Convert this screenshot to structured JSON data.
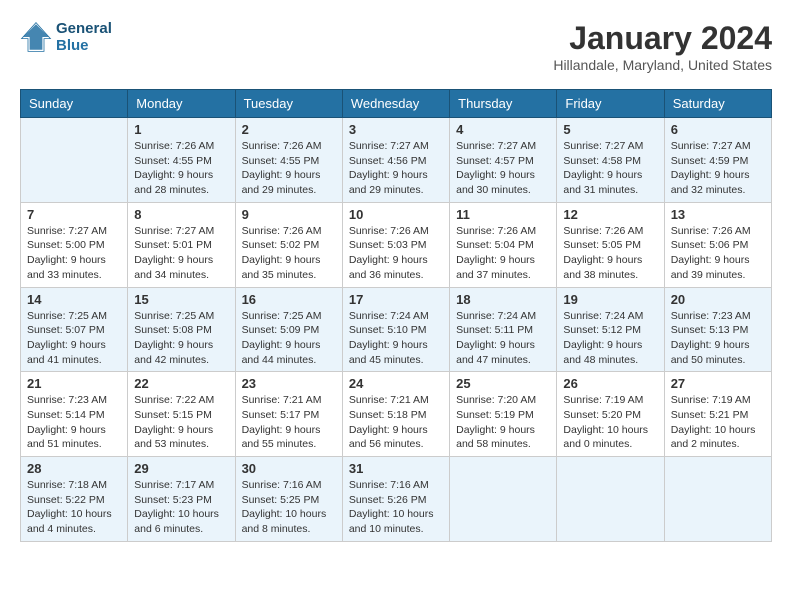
{
  "header": {
    "logo_line1": "General",
    "logo_line2": "Blue",
    "month": "January 2024",
    "location": "Hillandale, Maryland, United States"
  },
  "days_of_week": [
    "Sunday",
    "Monday",
    "Tuesday",
    "Wednesday",
    "Thursday",
    "Friday",
    "Saturday"
  ],
  "weeks": [
    [
      {
        "day": "",
        "info": ""
      },
      {
        "day": "1",
        "info": "Sunrise: 7:26 AM\nSunset: 4:55 PM\nDaylight: 9 hours\nand 28 minutes."
      },
      {
        "day": "2",
        "info": "Sunrise: 7:26 AM\nSunset: 4:55 PM\nDaylight: 9 hours\nand 29 minutes."
      },
      {
        "day": "3",
        "info": "Sunrise: 7:27 AM\nSunset: 4:56 PM\nDaylight: 9 hours\nand 29 minutes."
      },
      {
        "day": "4",
        "info": "Sunrise: 7:27 AM\nSunset: 4:57 PM\nDaylight: 9 hours\nand 30 minutes."
      },
      {
        "day": "5",
        "info": "Sunrise: 7:27 AM\nSunset: 4:58 PM\nDaylight: 9 hours\nand 31 minutes."
      },
      {
        "day": "6",
        "info": "Sunrise: 7:27 AM\nSunset: 4:59 PM\nDaylight: 9 hours\nand 32 minutes."
      }
    ],
    [
      {
        "day": "7",
        "info": "Sunrise: 7:27 AM\nSunset: 5:00 PM\nDaylight: 9 hours\nand 33 minutes."
      },
      {
        "day": "8",
        "info": "Sunrise: 7:27 AM\nSunset: 5:01 PM\nDaylight: 9 hours\nand 34 minutes."
      },
      {
        "day": "9",
        "info": "Sunrise: 7:26 AM\nSunset: 5:02 PM\nDaylight: 9 hours\nand 35 minutes."
      },
      {
        "day": "10",
        "info": "Sunrise: 7:26 AM\nSunset: 5:03 PM\nDaylight: 9 hours\nand 36 minutes."
      },
      {
        "day": "11",
        "info": "Sunrise: 7:26 AM\nSunset: 5:04 PM\nDaylight: 9 hours\nand 37 minutes."
      },
      {
        "day": "12",
        "info": "Sunrise: 7:26 AM\nSunset: 5:05 PM\nDaylight: 9 hours\nand 38 minutes."
      },
      {
        "day": "13",
        "info": "Sunrise: 7:26 AM\nSunset: 5:06 PM\nDaylight: 9 hours\nand 39 minutes."
      }
    ],
    [
      {
        "day": "14",
        "info": "Sunrise: 7:25 AM\nSunset: 5:07 PM\nDaylight: 9 hours\nand 41 minutes."
      },
      {
        "day": "15",
        "info": "Sunrise: 7:25 AM\nSunset: 5:08 PM\nDaylight: 9 hours\nand 42 minutes."
      },
      {
        "day": "16",
        "info": "Sunrise: 7:25 AM\nSunset: 5:09 PM\nDaylight: 9 hours\nand 44 minutes."
      },
      {
        "day": "17",
        "info": "Sunrise: 7:24 AM\nSunset: 5:10 PM\nDaylight: 9 hours\nand 45 minutes."
      },
      {
        "day": "18",
        "info": "Sunrise: 7:24 AM\nSunset: 5:11 PM\nDaylight: 9 hours\nand 47 minutes."
      },
      {
        "day": "19",
        "info": "Sunrise: 7:24 AM\nSunset: 5:12 PM\nDaylight: 9 hours\nand 48 minutes."
      },
      {
        "day": "20",
        "info": "Sunrise: 7:23 AM\nSunset: 5:13 PM\nDaylight: 9 hours\nand 50 minutes."
      }
    ],
    [
      {
        "day": "21",
        "info": "Sunrise: 7:23 AM\nSunset: 5:14 PM\nDaylight: 9 hours\nand 51 minutes."
      },
      {
        "day": "22",
        "info": "Sunrise: 7:22 AM\nSunset: 5:15 PM\nDaylight: 9 hours\nand 53 minutes."
      },
      {
        "day": "23",
        "info": "Sunrise: 7:21 AM\nSunset: 5:17 PM\nDaylight: 9 hours\nand 55 minutes."
      },
      {
        "day": "24",
        "info": "Sunrise: 7:21 AM\nSunset: 5:18 PM\nDaylight: 9 hours\nand 56 minutes."
      },
      {
        "day": "25",
        "info": "Sunrise: 7:20 AM\nSunset: 5:19 PM\nDaylight: 9 hours\nand 58 minutes."
      },
      {
        "day": "26",
        "info": "Sunrise: 7:19 AM\nSunset: 5:20 PM\nDaylight: 10 hours\nand 0 minutes."
      },
      {
        "day": "27",
        "info": "Sunrise: 7:19 AM\nSunset: 5:21 PM\nDaylight: 10 hours\nand 2 minutes."
      }
    ],
    [
      {
        "day": "28",
        "info": "Sunrise: 7:18 AM\nSunset: 5:22 PM\nDaylight: 10 hours\nand 4 minutes."
      },
      {
        "day": "29",
        "info": "Sunrise: 7:17 AM\nSunset: 5:23 PM\nDaylight: 10 hours\nand 6 minutes."
      },
      {
        "day": "30",
        "info": "Sunrise: 7:16 AM\nSunset: 5:25 PM\nDaylight: 10 hours\nand 8 minutes."
      },
      {
        "day": "31",
        "info": "Sunrise: 7:16 AM\nSunset: 5:26 PM\nDaylight: 10 hours\nand 10 minutes."
      },
      {
        "day": "",
        "info": ""
      },
      {
        "day": "",
        "info": ""
      },
      {
        "day": "",
        "info": ""
      }
    ]
  ]
}
